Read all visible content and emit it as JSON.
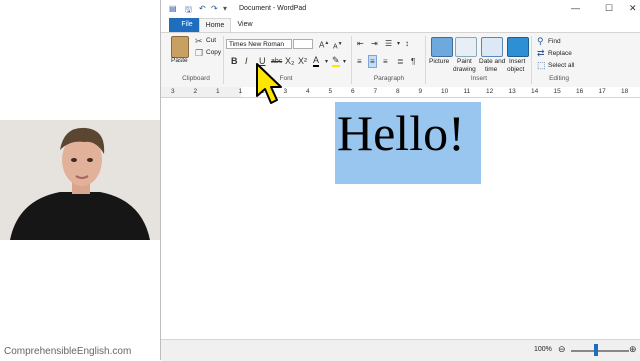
{
  "window": {
    "title": "Document - WordPad",
    "tabs": [
      {
        "label": "File"
      },
      {
        "label": "Home"
      },
      {
        "label": "View"
      }
    ]
  },
  "ribbon": {
    "clipboard": {
      "paste": "Paste",
      "cut": "Cut",
      "copy": "Copy",
      "group_label": "Clipboard"
    },
    "font": {
      "family": "Times New Roman",
      "size": "",
      "group_label": "Font"
    },
    "paragraph": {
      "group_label": "Paragraph"
    },
    "insert": {
      "picture": "Picture",
      "paint_drawing": [
        "Paint",
        "drawing"
      ],
      "date_time": [
        "Date and",
        "time"
      ],
      "insert_object": [
        "Insert",
        "object"
      ],
      "group_label": "Insert"
    },
    "editing": {
      "find": "Find",
      "replace": "Replace",
      "select_all": "Select all",
      "group_label": "Editing"
    }
  },
  "ruler": {
    "numbers": [
      "3",
      "2",
      "1",
      "1",
      "2",
      "3",
      "4",
      "5",
      "6",
      "7",
      "8",
      "9",
      "10",
      "11",
      "12",
      "13",
      "14",
      "15",
      "16",
      "17",
      "18"
    ]
  },
  "document": {
    "text": "Hello!"
  },
  "status": {
    "zoom": "100%"
  },
  "watermark": "ComprehensibleEnglish.com",
  "colors": {
    "accent": "#1e6ebd",
    "selection": "#99c6ee",
    "cursor": "#ffe600"
  }
}
